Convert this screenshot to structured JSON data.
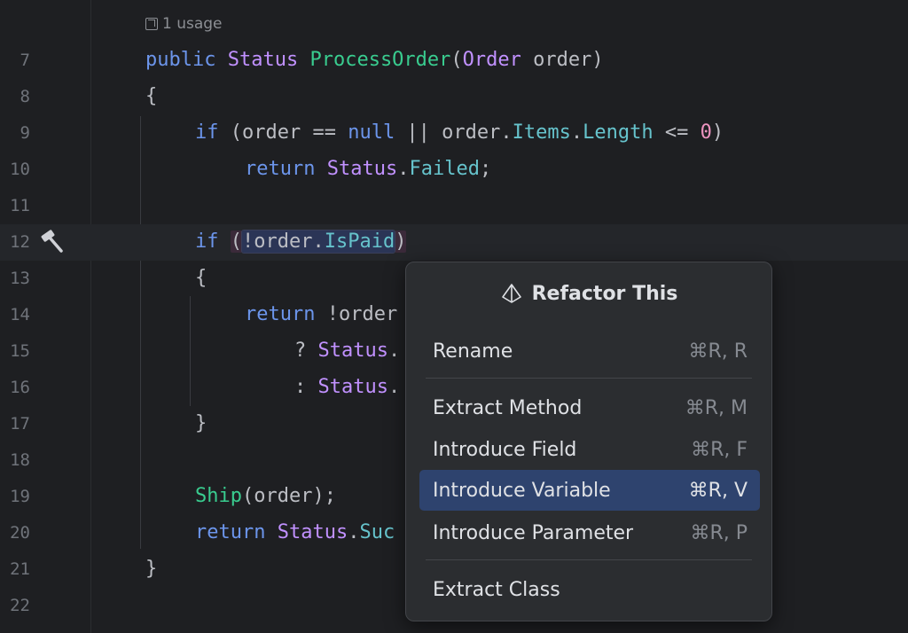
{
  "editor": {
    "usage_hint": "1 usage",
    "lines": [
      {
        "num": "7"
      },
      {
        "num": "8"
      },
      {
        "num": "9"
      },
      {
        "num": "10"
      },
      {
        "num": "11"
      },
      {
        "num": "12"
      },
      {
        "num": "13"
      },
      {
        "num": "14"
      },
      {
        "num": "15"
      },
      {
        "num": "16"
      },
      {
        "num": "17"
      },
      {
        "num": "18"
      },
      {
        "num": "19"
      },
      {
        "num": "20"
      },
      {
        "num": "21"
      },
      {
        "num": "22"
      }
    ],
    "gutter_icon": "hammer-icon"
  },
  "code": {
    "l7": {
      "kw": "public",
      "type": "Status",
      "method": "ProcessOrder",
      "p1": "(",
      "type2": "Order",
      "p2": " order)"
    },
    "l8": "{",
    "l9": {
      "kw": "if",
      "p1": " (order == ",
      "kw2": "null",
      "p2": " || order.",
      "prop1": "Items",
      "dot": ".",
      "prop2": "Length",
      "p3": " <= ",
      "num": "0",
      "p4": ")"
    },
    "l10": {
      "kw": "return",
      "sp": " ",
      "type": "Status",
      "dot": ".",
      "prop": "Failed",
      "end": ";"
    },
    "l12": {
      "kw": "if",
      "sp": " ",
      "open": "(",
      "sel": "!order.",
      "prop": "IsPaid",
      "close": ")"
    },
    "l13": "{",
    "l14": {
      "kw": "return",
      "rest": " !order"
    },
    "l15": {
      "q": "? ",
      "type": "Status",
      "dot": "."
    },
    "l16": {
      "c": ": ",
      "type": "Status",
      "dot": "."
    },
    "l17": "}",
    "l19": {
      "method": "Ship",
      "rest": "(order);"
    },
    "l20": {
      "kw": "return",
      "sp": " ",
      "type": "Status",
      "dot": ".",
      "prop": "Suc"
    },
    "l21": "}"
  },
  "popup": {
    "title": "Refactor This",
    "icon": "refactor-icon",
    "items": [
      {
        "label": "Rename",
        "shortcut": "⌘R, R"
      },
      {
        "label": "Extract Method",
        "shortcut": "⌘R, M"
      },
      {
        "label": "Introduce Field",
        "shortcut": "⌘R, F"
      },
      {
        "label": "Introduce Variable",
        "shortcut": "⌘R, V",
        "active": true
      },
      {
        "label": "Introduce Parameter",
        "shortcut": "⌘R, P"
      },
      {
        "label": "Extract Class",
        "shortcut": ""
      }
    ]
  },
  "colors": {
    "background": "#1e1f22",
    "keyword": "#6c95eb",
    "type": "#c191ff",
    "method": "#39cc8f",
    "property": "#66c3cc",
    "number": "#ed94c0",
    "menu_active": "#2e436e"
  }
}
